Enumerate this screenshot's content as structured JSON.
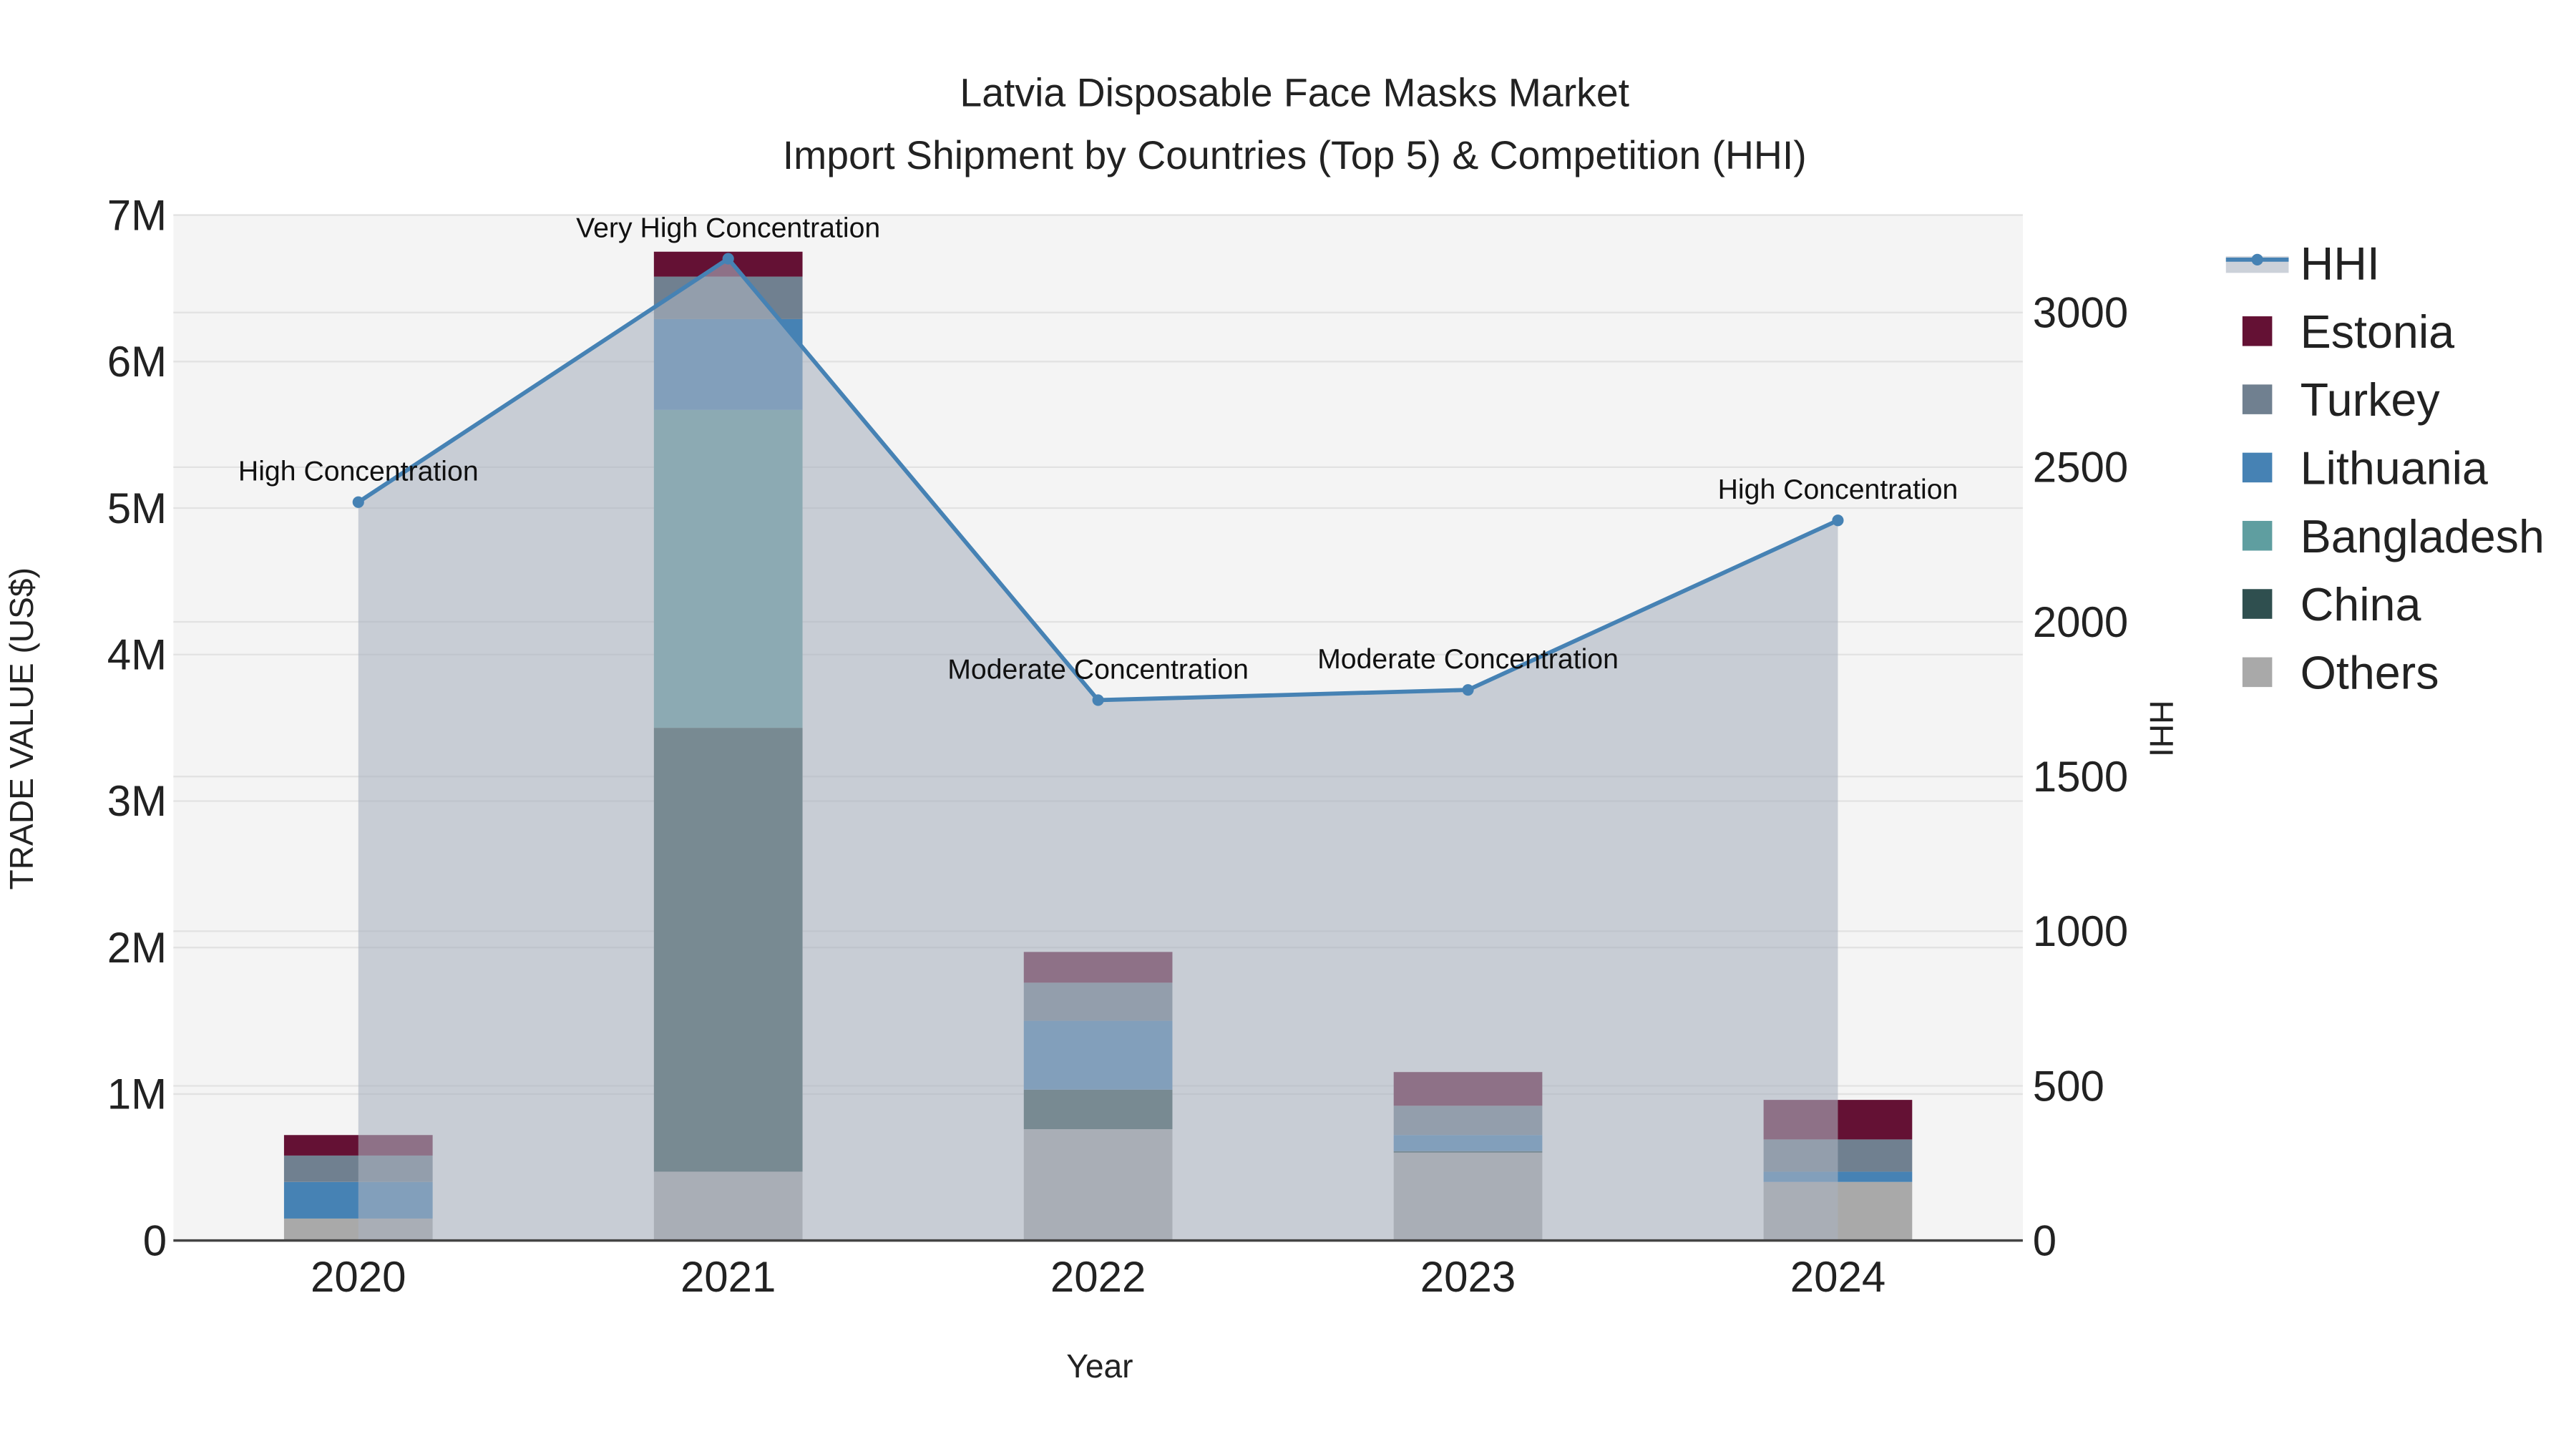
{
  "chart_data": {
    "type": "bar",
    "title_line1": "Latvia Disposable Face Masks Market",
    "title_line2": "Import Shipment by Countries (Top 5) & Competition (HHI)",
    "xlabel": "Year",
    "ylabel": "TRADE VALUE (US$)",
    "y2label": "HHI",
    "categories": [
      "2020",
      "2021",
      "2022",
      "2023",
      "2024"
    ],
    "ylim": [
      0,
      7000000
    ],
    "y_ticks": [
      0,
      1000000,
      2000000,
      3000000,
      4000000,
      5000000,
      6000000,
      7000000
    ],
    "y_tick_labels": [
      "0",
      "1M",
      "2M",
      "3M",
      "4M",
      "5M",
      "6M",
      "7M"
    ],
    "y2lim": [
      0,
      3315
    ],
    "y2_ticks": [
      0,
      500,
      1000,
      1500,
      2000,
      2500,
      3000
    ],
    "y2_tick_labels": [
      "0",
      "500",
      "1000",
      "1500",
      "2000",
      "2500",
      "3000"
    ],
    "series": [
      {
        "name": "Others",
        "color": "#A9A9A9",
        "values": [
          150000,
          470000,
          760000,
          600000,
          400000
        ]
      },
      {
        "name": "China",
        "color": "#2F4F4F",
        "values": [
          0,
          3030000,
          270000,
          10000,
          0
        ]
      },
      {
        "name": "Bangladesh",
        "color": "#5F9EA0",
        "values": [
          0,
          2170000,
          0,
          0,
          0
        ]
      },
      {
        "name": "Lithuania",
        "color": "#4682B4",
        "values": [
          250000,
          620000,
          470000,
          110000,
          70000
        ]
      },
      {
        "name": "Turkey",
        "color": "#708090",
        "values": [
          180000,
          290000,
          260000,
          200000,
          220000
        ]
      },
      {
        "name": "Estonia",
        "color": "#641134",
        "values": [
          140000,
          170000,
          210000,
          230000,
          270000
        ]
      }
    ],
    "hhi": {
      "name": "HHI",
      "color": "#4682B4",
      "values": [
        2387,
        3174,
        1747,
        1780,
        2328
      ],
      "annotations": [
        "High Concentration",
        "Very High Concentration",
        "Moderate Concentration",
        "Moderate Concentration",
        "High Concentration"
      ]
    },
    "legend": [
      "HHI",
      "Estonia",
      "Turkey",
      "Lithuania",
      "Bangladesh",
      "China",
      "Others"
    ],
    "legend_placement": "right",
    "grid": true
  }
}
